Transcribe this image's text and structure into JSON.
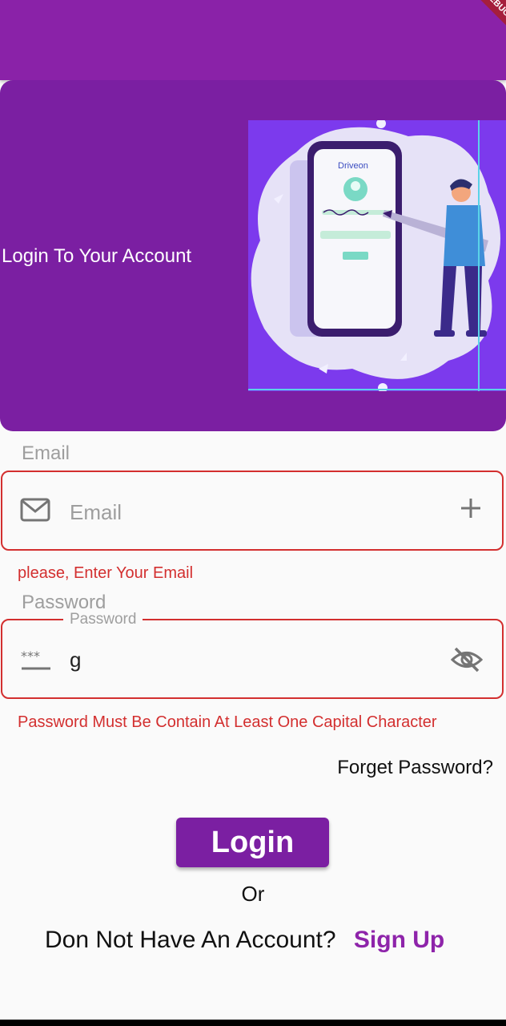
{
  "appbar": {
    "debug_banner": "DEBUG"
  },
  "hero": {
    "title": "Login To Your Account",
    "illustration_brand": "Driveon"
  },
  "email": {
    "caption": "Email",
    "placeholder": "Email",
    "prefix_icon": "mail-icon",
    "suffix_icon": "plus-icon",
    "error": "please, Enter Your Email"
  },
  "password": {
    "caption": "Password",
    "floating_label": "Password",
    "value": "g",
    "prefix_icon": "password-icon",
    "suffix_icon": "visibility-off-icon",
    "error": "Password Must Be Contain At Least One Capital Character"
  },
  "actions": {
    "forget_password": "Forget Password?",
    "login": "Login",
    "or": "Or",
    "no_account": "Don Not Have An Account?",
    "signup": "Sign Up"
  },
  "colors": {
    "primary": "#7b1fa2",
    "appbar": "#8a22a8",
    "error": "#d32f2f",
    "link": "#8e24aa"
  }
}
